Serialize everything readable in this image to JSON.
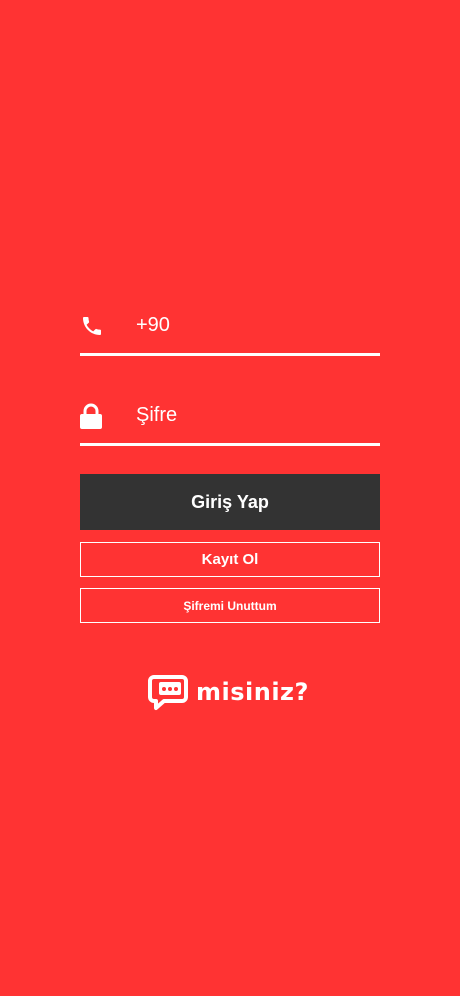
{
  "colors": {
    "background": "#ff3333",
    "primary_button": "#333333",
    "text": "#ffffff"
  },
  "phone": {
    "icon": "phone-icon",
    "value": "+90"
  },
  "password": {
    "icon": "lock-icon",
    "placeholder": "Şifre"
  },
  "buttons": {
    "login": "Giriş Yap",
    "register": "Kayıt Ol",
    "forgot": "Şifremi Unuttum"
  },
  "logo": {
    "icon": "chat-bubble-icon",
    "text": "misiniz?"
  }
}
